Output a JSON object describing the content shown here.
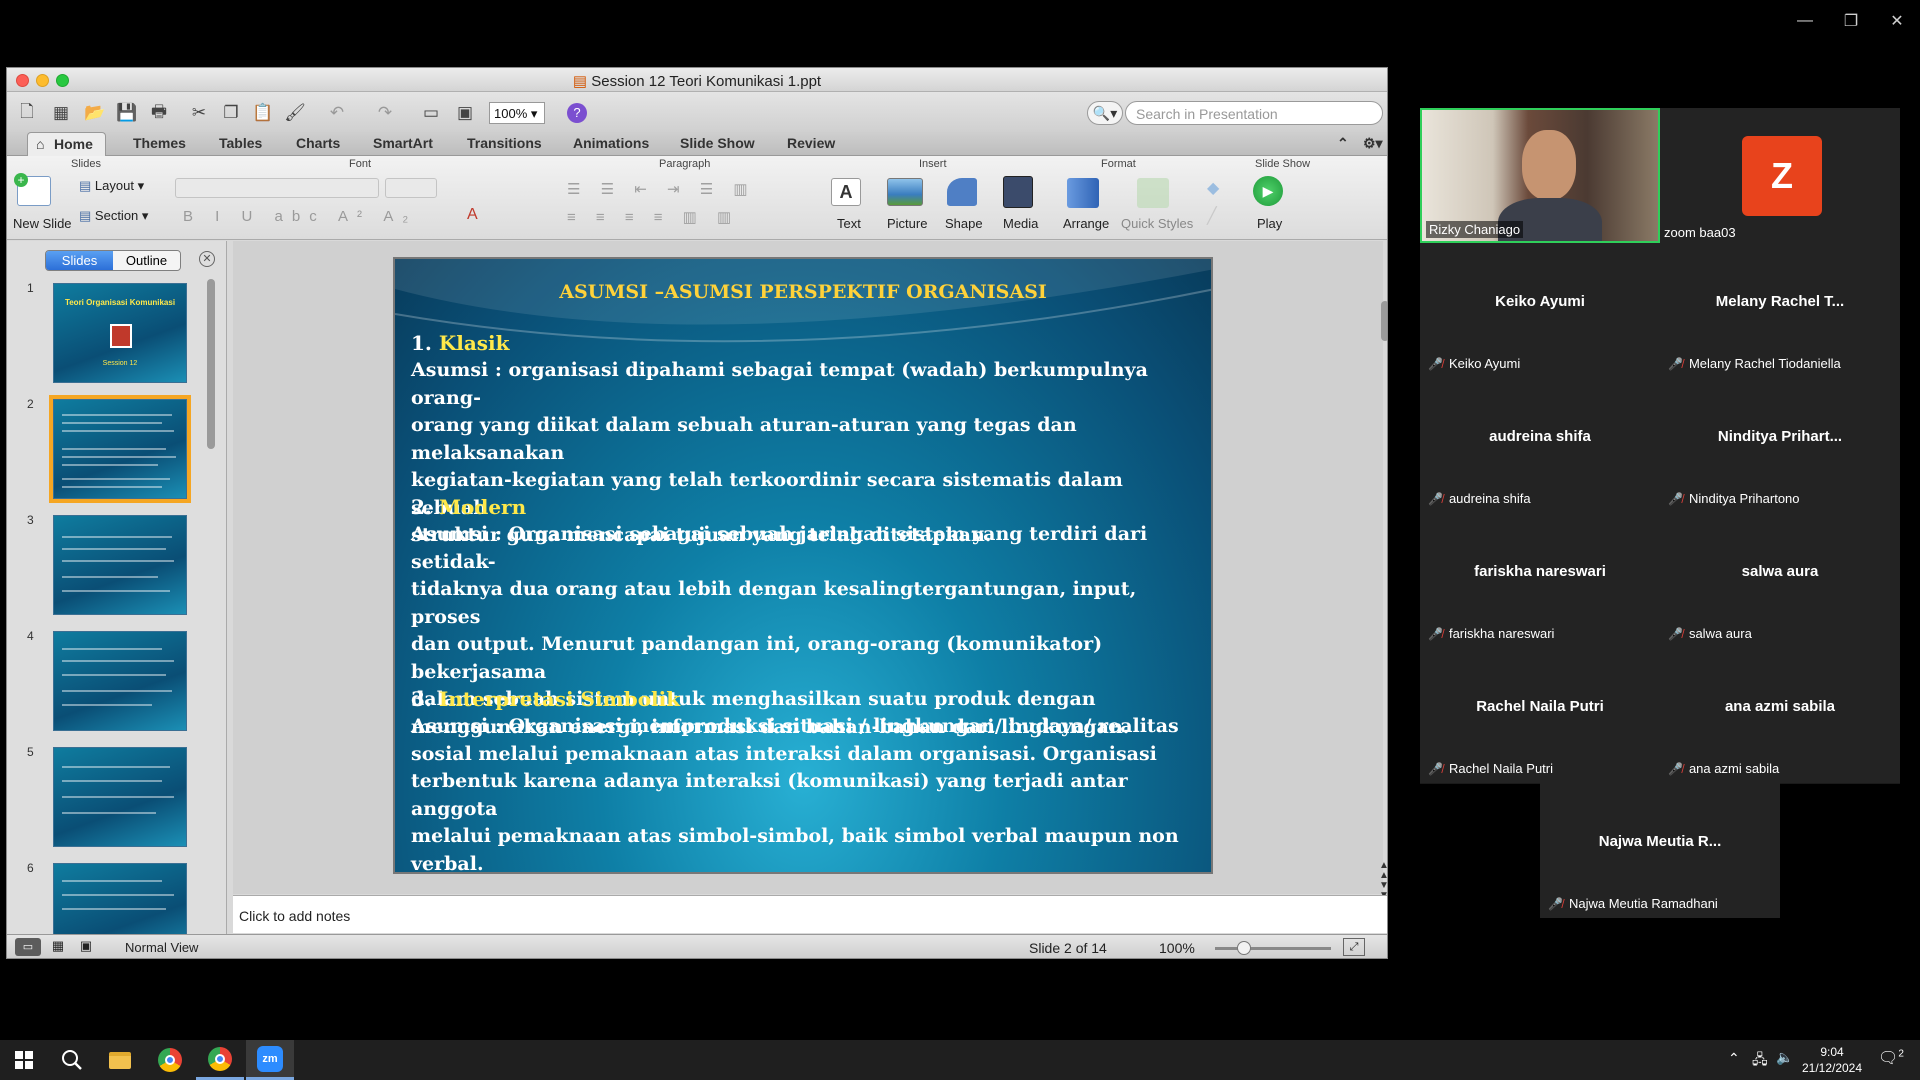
{
  "zoom_window": {
    "minimize": "—",
    "restore": "❐",
    "close": "✕"
  },
  "ppt": {
    "title": "Session 12 Teori Komunikasi 1.ppt",
    "zoom": "100%",
    "search_placeholder": "Search in Presentation",
    "tabs": [
      "Home",
      "Themes",
      "Tables",
      "Charts",
      "SmartArt",
      "Transitions",
      "Animations",
      "Slide Show",
      "Review"
    ],
    "groups": {
      "slides": "Slides",
      "font": "Font",
      "paragraph": "Paragraph",
      "insert": "Insert",
      "format": "Format",
      "slideshow": "Slide Show"
    },
    "ribbon": {
      "new_slide": "New Slide",
      "layout": "Layout",
      "section": "Section",
      "text": "Text",
      "picture": "Picture",
      "shape": "Shape",
      "media": "Media",
      "arrange": "Arrange",
      "quick_styles": "Quick Styles",
      "play": "Play"
    },
    "panel": {
      "slides_tab": "Slides",
      "outline_tab": "Outline",
      "thumb_numbers": [
        "1",
        "2",
        "3",
        "4",
        "5",
        "6"
      ],
      "thumb1_title": "Teori Organisasi Komunikasi",
      "thumb1_sub": "Session 12"
    },
    "slide": {
      "title": "ASUMSI –ASUMSI PERSPEKTIF ORGANISASI",
      "s1_num": "1.",
      "s1_head": "Klasik",
      "s1_line1": "Asumsi : organisasi dipahami sebagai tempat (wadah) berkumpulnya orang-",
      "s1_line2": "orang yang diikat dalam sebuah aturan-aturan yang tegas dan melaksanakan",
      "s1_line3": "kegiatan-kegiatan yang telah terkoordinir secara sistematis dalam sebuah",
      "s1_line4": "struktur guna mencapai tujuan yang telah ditetapkan.",
      "s2_num": "2.",
      "s2_head": "Modern",
      "s2_line1": "Asumsi : Organisasi sebagai sebuah jaringan sistem yang terdiri dari setidak-",
      "s2_line2": "tidaknya dua orang atau lebih dengan kesalingtergantungan, input, proses",
      "s2_line3": "dan output. Menurut pandangan ini, orang-orang (komunikator) bekerjasama",
      "s2_line4": "dalam sebuah sistem untuk menghasilkan suatu produk dengan",
      "s2_line5": "menggunakan energi, informasi dan bahan-bahan dari lingkungan.",
      "s3_num": "3.",
      "s3_head": "Interpretasi Simbolik",
      "s3_line1": "Asumsi : Organisasi memproduksi situasi / lingkungan/ budaya/ realitas",
      "s3_line2": "sosial melalui pemaknaan atas interaksi dalam organisasi. Organisasi",
      "s3_line3": "terbentuk karena adanya interaksi (komunikasi) yang terjadi antar anggota",
      "s3_line4": "melalui pemaknaan atas simbol-simbol, baik simbol verbal maupun non",
      "s3_line5": "verbal."
    },
    "notes_placeholder": "Click to add notes",
    "status": {
      "view": "Normal View",
      "slide_of": "Slide 2 of 14",
      "zoom": "100%"
    }
  },
  "gallery": {
    "active_speaker": "Rizky Chaniago",
    "avatar_letter": "Z",
    "avatar_color": "#e8431c",
    "avatar_name": "zoom baa03",
    "participants": [
      {
        "big": "Keiko Ayumi",
        "small": "Keiko Ayumi"
      },
      {
        "big": "Melany Rachel T...",
        "small": "Melany Rachel Tiodaniella"
      },
      {
        "big": "audreina shifa",
        "small": "audreina shifa"
      },
      {
        "big": "Ninditya Prihart...",
        "small": "Ninditya Prihartono"
      },
      {
        "big": "fariskha nareswari",
        "small": "fariskha nareswari"
      },
      {
        "big": "salwa aura",
        "small": "salwa aura"
      },
      {
        "big": "Rachel Naila Putri",
        "small": "Rachel Naila Putri"
      },
      {
        "big": "ana azmi sabila",
        "small": "ana azmi sabila"
      },
      {
        "big": "Najwa Meutia R...",
        "small": "Najwa Meutia Ramadhani"
      }
    ]
  },
  "taskbar": {
    "time": "9:04",
    "date": "21/12/2024",
    "notif_count": "2",
    "zoom_label": "zm"
  }
}
